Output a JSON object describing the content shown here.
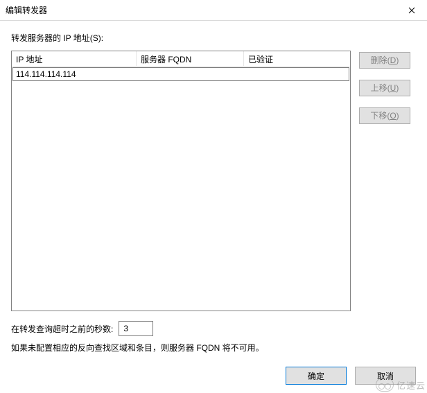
{
  "window": {
    "title": "编辑转发器"
  },
  "labels": {
    "ip_list": "转发服务器的 IP 地址(S):",
    "timeout": "在转发查询超时之前的秒数:",
    "note": "如果未配置相应的反向查找区域和条目，则服务器 FQDN 将不可用。"
  },
  "columns": {
    "ip": "IP 地址",
    "fqdn": "服务器 FQDN",
    "verified": "已验证"
  },
  "entry": {
    "ip_value": "114.114.114.114"
  },
  "side_buttons": {
    "delete": "删除",
    "delete_key": "D",
    "up": "上移",
    "up_key": "U",
    "down": "下移",
    "down_key": "O"
  },
  "timeout": {
    "value": "3"
  },
  "footer": {
    "ok": "确定",
    "cancel": "取消"
  },
  "watermark": {
    "text": "亿速云"
  }
}
